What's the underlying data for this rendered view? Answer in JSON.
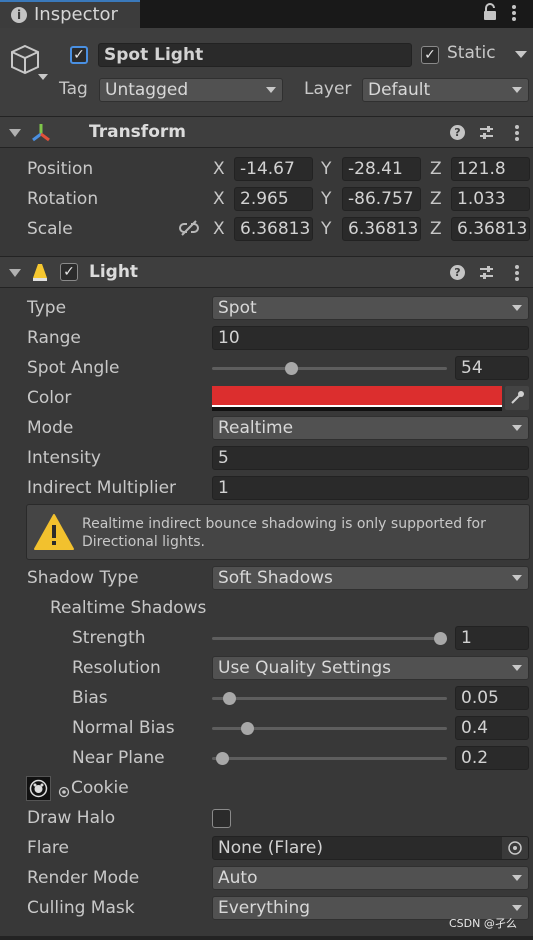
{
  "window": {
    "tab_title": "Inspector"
  },
  "object": {
    "name": "Spot Light",
    "active": true,
    "static_label": "Static",
    "static_checked": true,
    "tag_label": "Tag",
    "tag_value": "Untagged",
    "layer_label": "Layer",
    "layer_value": "Default"
  },
  "transform": {
    "title": "Transform",
    "rows": [
      {
        "label": "Position",
        "x": "-14.67",
        "y": "-28.41",
        "z": "121.8"
      },
      {
        "label": "Rotation",
        "x": "2.965",
        "y": "-86.757",
        "z": "1.033"
      },
      {
        "label": "Scale",
        "x": "6.36813",
        "y": "6.36813",
        "z": "6.36813"
      }
    ],
    "axis_x": "X",
    "axis_y": "Y",
    "axis_z": "Z"
  },
  "light": {
    "title": "Light",
    "enabled": true,
    "type": {
      "label": "Type",
      "value": "Spot"
    },
    "range": {
      "label": "Range",
      "value": "10"
    },
    "spot_angle": {
      "label": "Spot Angle",
      "value": "54",
      "slider_fraction": 0.33
    },
    "color": {
      "label": "Color",
      "value": "#dc2e2e"
    },
    "mode": {
      "label": "Mode",
      "value": "Realtime"
    },
    "intensity": {
      "label": "Intensity",
      "value": "5"
    },
    "indirect": {
      "label": "Indirect Multiplier",
      "value": "1"
    },
    "warning": "Realtime indirect bounce shadowing is only supported for Directional lights.",
    "shadow_type": {
      "label": "Shadow Type",
      "value": "Soft Shadows"
    },
    "realtime_shadows": "Realtime Shadows",
    "strength": {
      "label": "Strength",
      "value": "1",
      "slider_fraction": 1.0
    },
    "resolution": {
      "label": "Resolution",
      "value": "Use Quality Settings"
    },
    "bias": {
      "label": "Bias",
      "value": "0.05",
      "slider_fraction": 0.05
    },
    "normal_bias": {
      "label": "Normal Bias",
      "value": "0.4",
      "slider_fraction": 0.13
    },
    "near_plane": {
      "label": "Near Plane",
      "value": "0.2",
      "slider_fraction": 0.02
    },
    "cookie": {
      "label": "Cookie"
    },
    "draw_halo": {
      "label": "Draw Halo",
      "checked": false
    },
    "flare": {
      "label": "Flare",
      "value": "None (Flare)"
    },
    "render_mode": {
      "label": "Render Mode",
      "value": "Auto"
    },
    "culling_mask": {
      "label": "Culling Mask",
      "value": "Everything"
    }
  },
  "watermark": "CSDN @孑么"
}
